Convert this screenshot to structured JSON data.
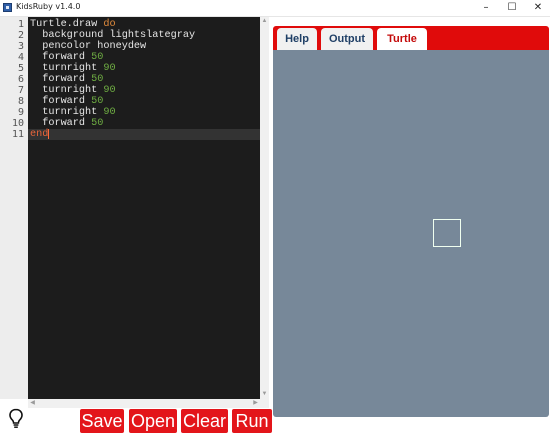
{
  "window": {
    "title": "KidsRuby v1.4.0",
    "controls": {
      "minimize": "–",
      "maximize": "☐",
      "close": "✕"
    }
  },
  "editor": {
    "line_numbers": [
      "1",
      "2",
      "3",
      "4",
      "5",
      "6",
      "7",
      "8",
      "9",
      "10",
      "11"
    ],
    "lines": [
      {
        "parts": [
          {
            "t": "Turtle.draw ",
            "c": "plain"
          },
          {
            "t": "do",
            "c": "kw"
          }
        ]
      },
      {
        "parts": [
          {
            "t": "  background lightslategray",
            "c": "plain"
          }
        ]
      },
      {
        "parts": [
          {
            "t": "  pencolor honeydew",
            "c": "plain"
          }
        ]
      },
      {
        "parts": [
          {
            "t": "  forward ",
            "c": "plain"
          },
          {
            "t": "50",
            "c": "num"
          }
        ]
      },
      {
        "parts": [
          {
            "t": "  turnright ",
            "c": "plain"
          },
          {
            "t": "90",
            "c": "num"
          }
        ]
      },
      {
        "parts": [
          {
            "t": "  forward ",
            "c": "plain"
          },
          {
            "t": "50",
            "c": "num"
          }
        ]
      },
      {
        "parts": [
          {
            "t": "  turnright ",
            "c": "plain"
          },
          {
            "t": "90",
            "c": "num"
          }
        ]
      },
      {
        "parts": [
          {
            "t": "  forward ",
            "c": "plain"
          },
          {
            "t": "50",
            "c": "num"
          }
        ]
      },
      {
        "parts": [
          {
            "t": "  turnright ",
            "c": "plain"
          },
          {
            "t": "90",
            "c": "num"
          }
        ]
      },
      {
        "parts": [
          {
            "t": "  forward ",
            "c": "plain"
          },
          {
            "t": "50",
            "c": "num"
          }
        ]
      },
      {
        "parts": [
          {
            "t": "end",
            "c": "kw-end"
          }
        ]
      }
    ],
    "current_line_index": 10
  },
  "toolbar": {
    "bulb_icon": "lightbulb-icon",
    "save_label": "Save",
    "open_label": "Open",
    "clear_label": "Clear",
    "run_label": "Run"
  },
  "tabs": [
    {
      "label": "Help",
      "active": false
    },
    {
      "label": "Output",
      "active": false
    },
    {
      "label": "Turtle",
      "active": true
    }
  ],
  "colors": {
    "accent": "#e00b0b",
    "button": "#e3151a",
    "canvas_background": "#778899",
    "pen": "#f0fff0"
  }
}
